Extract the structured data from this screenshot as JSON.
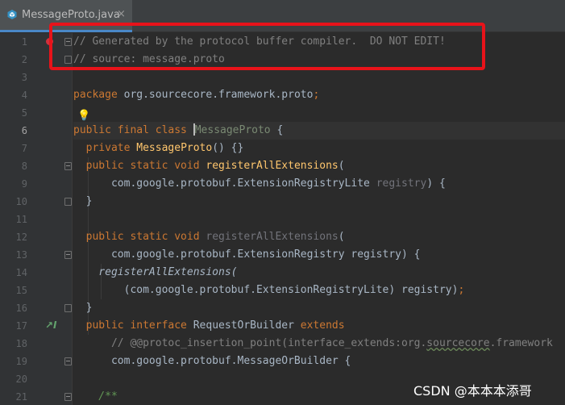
{
  "tab": {
    "filename": "MessageProto.java",
    "close_glyph": "×"
  },
  "gutter": {
    "line_numbers": [
      "1",
      "2",
      "3",
      "4",
      "5",
      "6",
      "7",
      "8",
      "9",
      "10",
      "11",
      "12",
      "13",
      "14",
      "15",
      "16",
      "17",
      "18",
      "19",
      "20",
      "21"
    ],
    "current_line": "6"
  },
  "code": {
    "l1": "// Generated by the protocol buffer compiler.  DO NOT EDIT!",
    "l2": "// source: message.proto",
    "l4_kw": "package",
    "l4_rest": " org.sourcecore.framework.proto",
    "l4_semi": ";",
    "l6_kw": "public final class ",
    "l6_cls": "MessageProto",
    "l6_rest": " {",
    "l7_kw": "  private ",
    "l7_fn": "MessageProto",
    "l7_rest": "() {}",
    "l8_kw": "  public static void ",
    "l8_fn": "registerAllExtensions",
    "l8_rest": "(",
    "l9_a": "      com.google.protobuf.ExtensionRegistryLite ",
    "l9_par": "registry",
    "l9_b": ") {",
    "l10": "  }",
    "l12_kw": "  public static void ",
    "l12_fn": "registerAllExtensions",
    "l12_rest": "(",
    "l13": "      com.google.protobuf.ExtensionRegistry registry) {",
    "l14": "    registerAllExtensions(",
    "l15_a": "        (com.google.protobuf.ExtensionRegistryLite) registry)",
    "l15_semi": ";",
    "l16": "  }",
    "l17_kw": "  public interface ",
    "l17_cls": "RequestOrBuilder ",
    "l17_ext": "extends",
    "l18_a": "      // @@protoc_insertion_point(interface_extends:org.",
    "l18_sq": "sourcecore",
    "l18_b": ".framework",
    "l19": "      com.google.protobuf.MessageOrBuilder {",
    "l21": "    /**"
  },
  "watermark": "CSDN @本本本添哥",
  "colors": {
    "highlight_box": "#e8131a",
    "keyword": "#cc7832",
    "comment": "#808080",
    "function": "#ffc66d"
  }
}
